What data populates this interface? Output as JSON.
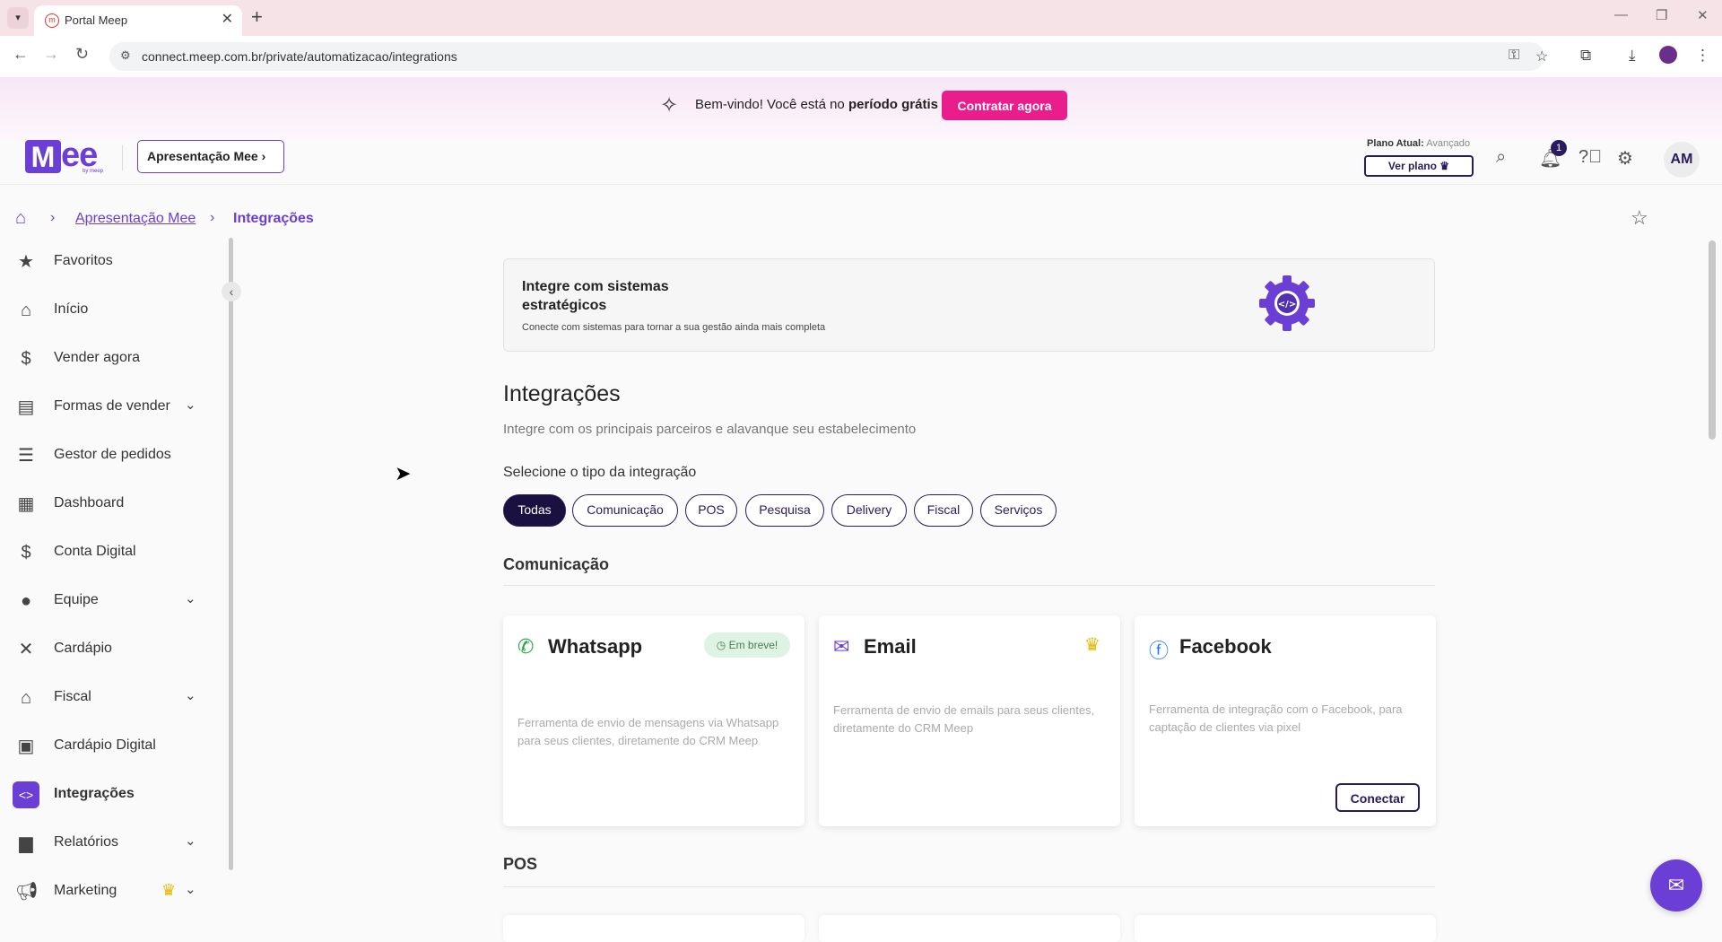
{
  "browser": {
    "tab_title": "Portal Meep",
    "url": "connect.meep.com.br/private/automatizacao/integrations"
  },
  "banner": {
    "text_before": "Bem-vindo! Você está no ",
    "text_bold": "período grátis",
    "cta": "Contratar agora"
  },
  "header": {
    "logo_text": "ee",
    "logo_sub": "by meep",
    "store_button": "Apresentação Mee",
    "plan_label": "Plano Atual:",
    "plan_value": "Avançado",
    "plan_button": "Ver plano",
    "notification_count": "1",
    "avatar_initials": "AM"
  },
  "breadcrumb": {
    "link": "Apresentação Mee",
    "current": "Integrações"
  },
  "sidebar": {
    "items": [
      {
        "label": "Favoritos",
        "icon": "star-icon"
      },
      {
        "label": "Início",
        "icon": "home-icon"
      },
      {
        "label": "Vender agora",
        "icon": "dollar-icon"
      },
      {
        "label": "Formas de vender",
        "icon": "register-icon"
      },
      {
        "label": "Gestor de pedidos",
        "icon": "list-icon"
      },
      {
        "label": "Dashboard",
        "icon": "dashboard-icon"
      },
      {
        "label": "Conta Digital",
        "icon": "dollar-icon"
      },
      {
        "label": "Equipe",
        "icon": "person-icon"
      },
      {
        "label": "Cardápio",
        "icon": "cutlery-icon"
      },
      {
        "label": "Fiscal",
        "icon": "bank-icon"
      },
      {
        "label": "Cardápio Digital",
        "icon": "qr-icon"
      },
      {
        "label": "Integrações",
        "icon": "code-icon"
      },
      {
        "label": "Relatórios",
        "icon": "document-icon"
      },
      {
        "label": "Marketing",
        "icon": "megaphone-icon"
      }
    ]
  },
  "hero": {
    "title": "Integre com sistemas estratégicos",
    "subtitle": "Conecte com sistemas para tornar a sua gestão ainda mais completa"
  },
  "main": {
    "title": "Integrações",
    "subtitle": "Integre com os principais parceiros e alavanque seu estabelecimento",
    "filter_label": "Selecione o tipo da integração",
    "filters": [
      "Todas",
      "Comunicação",
      "POS",
      "Pesquisa",
      "Delivery",
      "Fiscal",
      "Serviços"
    ],
    "section_comunicacao": "Comunicação",
    "section_pos": "POS"
  },
  "cards": [
    {
      "title": "Whatsapp",
      "icon": "whatsapp-icon",
      "badge": "Em breve!",
      "description": "Ferramenta de envio de mensagens via Whatsapp para seus clientes, diretamente do CRM Meep"
    },
    {
      "title": "Email",
      "icon": "email-icon",
      "badge": "crown-icon",
      "description": "Ferramenta de envio de emails para seus clientes, diretamente do CRM Meep"
    },
    {
      "title": "Facebook",
      "icon": "facebook-icon",
      "button": "Conectar",
      "description": "Ferramenta de integração com o Facebook, para captação de clientes via pixel"
    }
  ],
  "colors": {
    "brand": "#6b3ed6",
    "dark": "#2a1a5e",
    "cta": "#e91e8c",
    "badge_green": "#dff3e4",
    "crown": "#e5b700"
  }
}
